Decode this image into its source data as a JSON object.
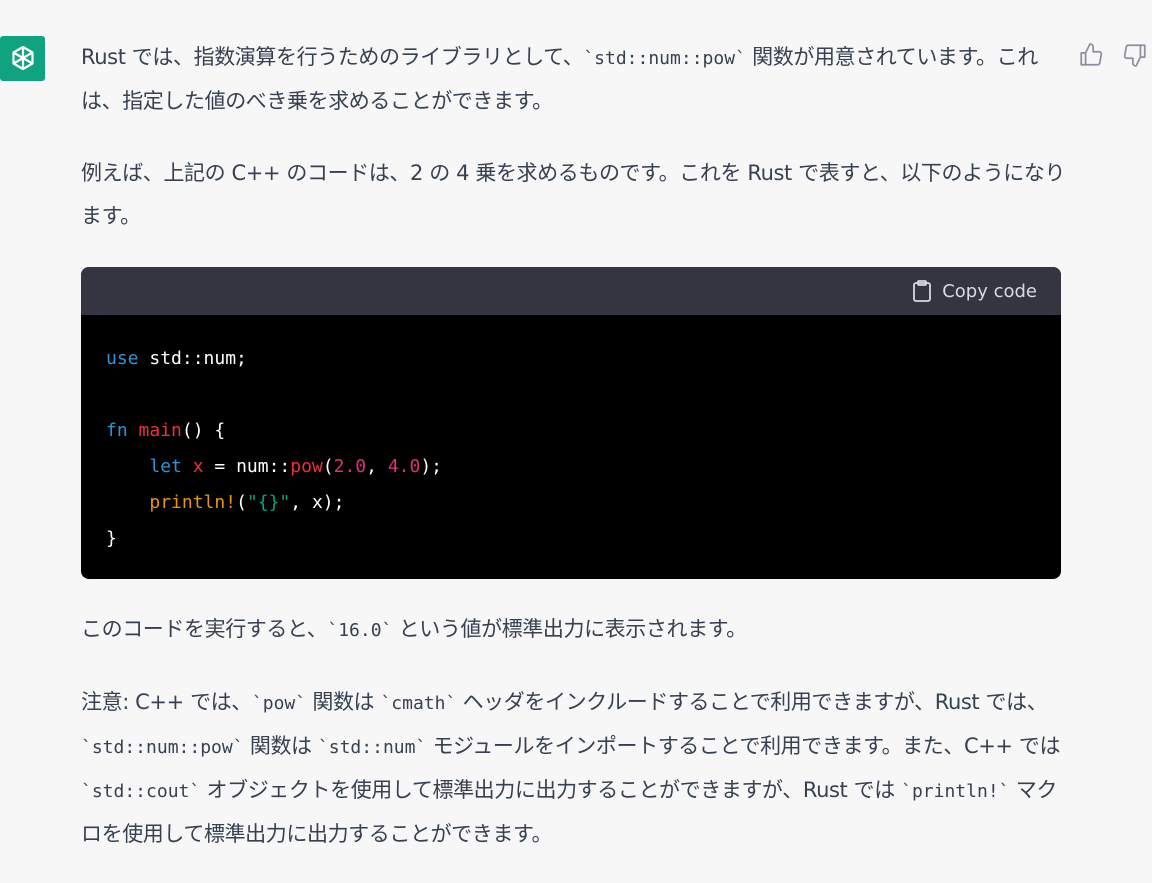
{
  "colors": {
    "avatar_bg": "#10a37f",
    "page_bg": "#f7f7f8",
    "code_header_bg": "#343541",
    "code_bg": "#000000",
    "keyword": "#2e95d3",
    "function": "#f22c3d",
    "string": "#00a67d",
    "macro": "#e9950c",
    "number": "#df3079"
  },
  "icons": {
    "avatar": "openai-logo-icon",
    "like": "thumbs-up-icon",
    "dislike": "thumbs-down-icon",
    "copy": "clipboard-icon"
  },
  "message": {
    "p1": [
      "Rust では、指数演算を行うためのライブラリとして、",
      "`std::num::pow`",
      " 関数が用意されています。これは、指定した値のべき乗を求めることができます。"
    ],
    "p2": "例えば、上記の C++ のコードは、2 の 4 乗を求めるものです。これを Rust で表すと、以下のようになります。",
    "code": {
      "copy_label": "Copy code",
      "line1": {
        "kw": "use",
        "rest": " std::num;"
      },
      "line3": {
        "kw": "fn",
        "sp": " ",
        "fn": "main",
        "rest": "() {"
      },
      "line4": {
        "indent": "    ",
        "kw": "let",
        "sp1": " ",
        "var": "x",
        "mid1": " = num::",
        "fn": "pow",
        "open": "(",
        "n1": "2.0",
        "comma": ", ",
        "n2": "4.0",
        "close": ");"
      },
      "line5": {
        "indent": "    ",
        "mac": "println!",
        "open": "(",
        "str": "\"{}\"",
        "rest": ", x);"
      },
      "line6": "}"
    },
    "p3": [
      "このコードを実行すると、",
      "`16.0`",
      " という値が標準出力に表示されます。"
    ],
    "p4": [
      "注意: C++ では、",
      "`pow`",
      " 関数は ",
      "`cmath`",
      " ヘッダをインクルードすることで利用できますが、Rust では、",
      "`std::num::pow`",
      " 関数は ",
      "`std::num`",
      " モジュールをインポートすることで利用できます。また、C++ では ",
      "`std::cout`",
      " オブジェクトを使用して標準出力に出力することができますが、Rust では ",
      "`println!`",
      " マクロを使用して標準出力に出力することができます。"
    ]
  }
}
